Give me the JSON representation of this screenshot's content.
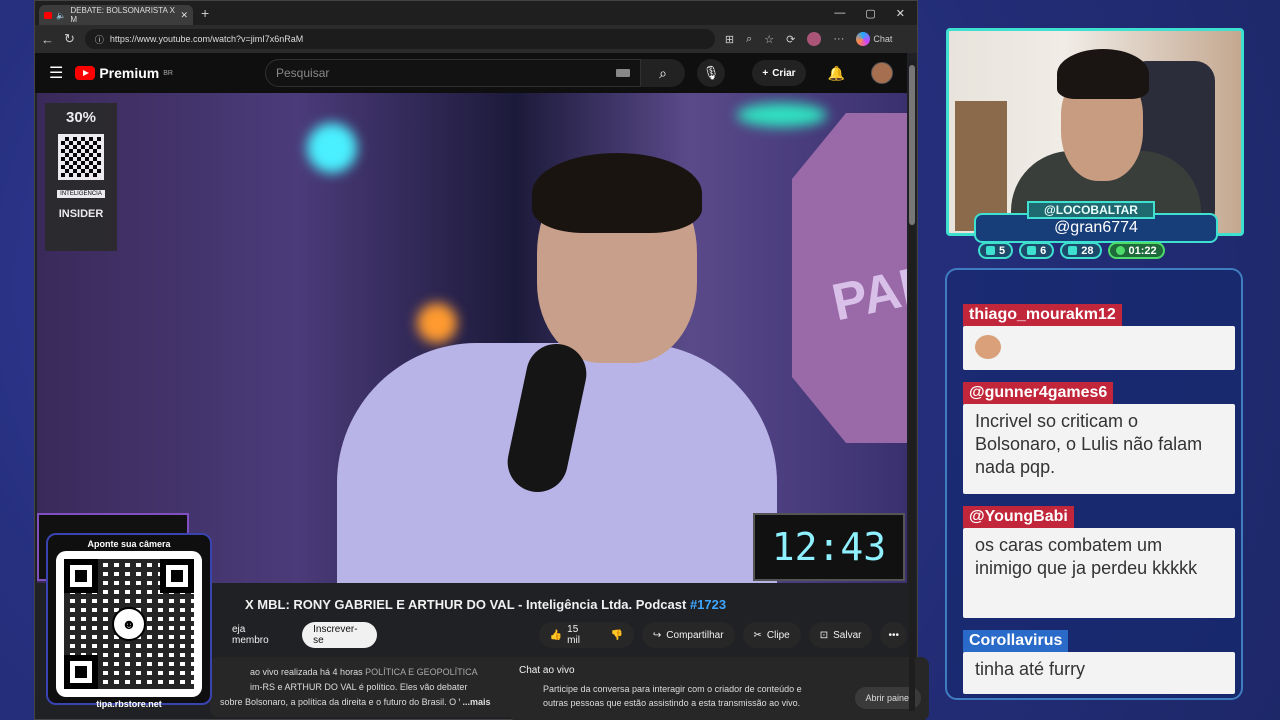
{
  "browser": {
    "tab_title": "DEBATE: BOLSONARISTA X M",
    "url": "https://www.youtube.com/watch?v=jimI7x6nRaM",
    "chat_label": "Chat"
  },
  "youtube": {
    "logo": "Premium",
    "region": "BR",
    "search_placeholder": "Pesquisar",
    "create_label": "Criar"
  },
  "video": {
    "title_partial": "X MBL: RONY GABRIEL E ARTHUR DO VAL - Inteligência Ltda. Podcast ",
    "episode": "#1723",
    "clock": "12:43",
    "ad_discount": "30%",
    "ad_brand": "INTELIGENCIA",
    "ad_sponsor": "INSIDER",
    "stop_text": "PAR"
  },
  "actions": {
    "member": "eja membro",
    "subscribe": "Inscrever-se",
    "likes": "15 mil",
    "share": "Compartilhar",
    "clip": "Clipe",
    "save": "Salvar"
  },
  "description": {
    "meta": "ao vivo realizada há 4 horas",
    "tags": "POLÍTICA E GEOPOLÍTICA",
    "line2": "im-RS e ARTHUR DO VAL é político. Eles vão debater",
    "line3": "sobre Bolsonaro, a política da direita e o futuro do Brasil. O Vilela se preocupa muito",
    "more": "...mais"
  },
  "live_chat": {
    "header": "Chat ao vivo",
    "text": "Participe da conversa para interagir com o criador de conteúdo e outras pessoas que estão assistindo a esta transmissão ao vivo.",
    "open_panel": "Abrir painel"
  },
  "qr_card": {
    "top": "Aponte sua câmera",
    "bottom": "tipa.rbstore.net"
  },
  "streamer": {
    "handle": "@LOCOBALTAR",
    "sub": "@gran6774",
    "stats": [
      {
        "icon": "twitch-icon",
        "value": "5"
      },
      {
        "icon": "youtube-icon",
        "value": "6"
      },
      {
        "icon": "kick-icon",
        "value": "28"
      },
      {
        "icon": "timer-icon",
        "value": "01:22"
      }
    ]
  },
  "chat": [
    {
      "user": "thiago_mourakm12",
      "text": "",
      "emote": true,
      "color": "#c2263a"
    },
    {
      "user": "@gunner4games6",
      "text": "Incrivel so criticam o Bolsonaro, o Lulis não falam nada pqp.",
      "color": "#c2263a"
    },
    {
      "user": "@YoungBabi",
      "text": "os caras combatem um inimigo que ja perdeu kkkkk",
      "color": "#c2263a"
    },
    {
      "user": "Corollavirus",
      "text": "tinha até furry",
      "color": "#2a6ac8"
    }
  ]
}
